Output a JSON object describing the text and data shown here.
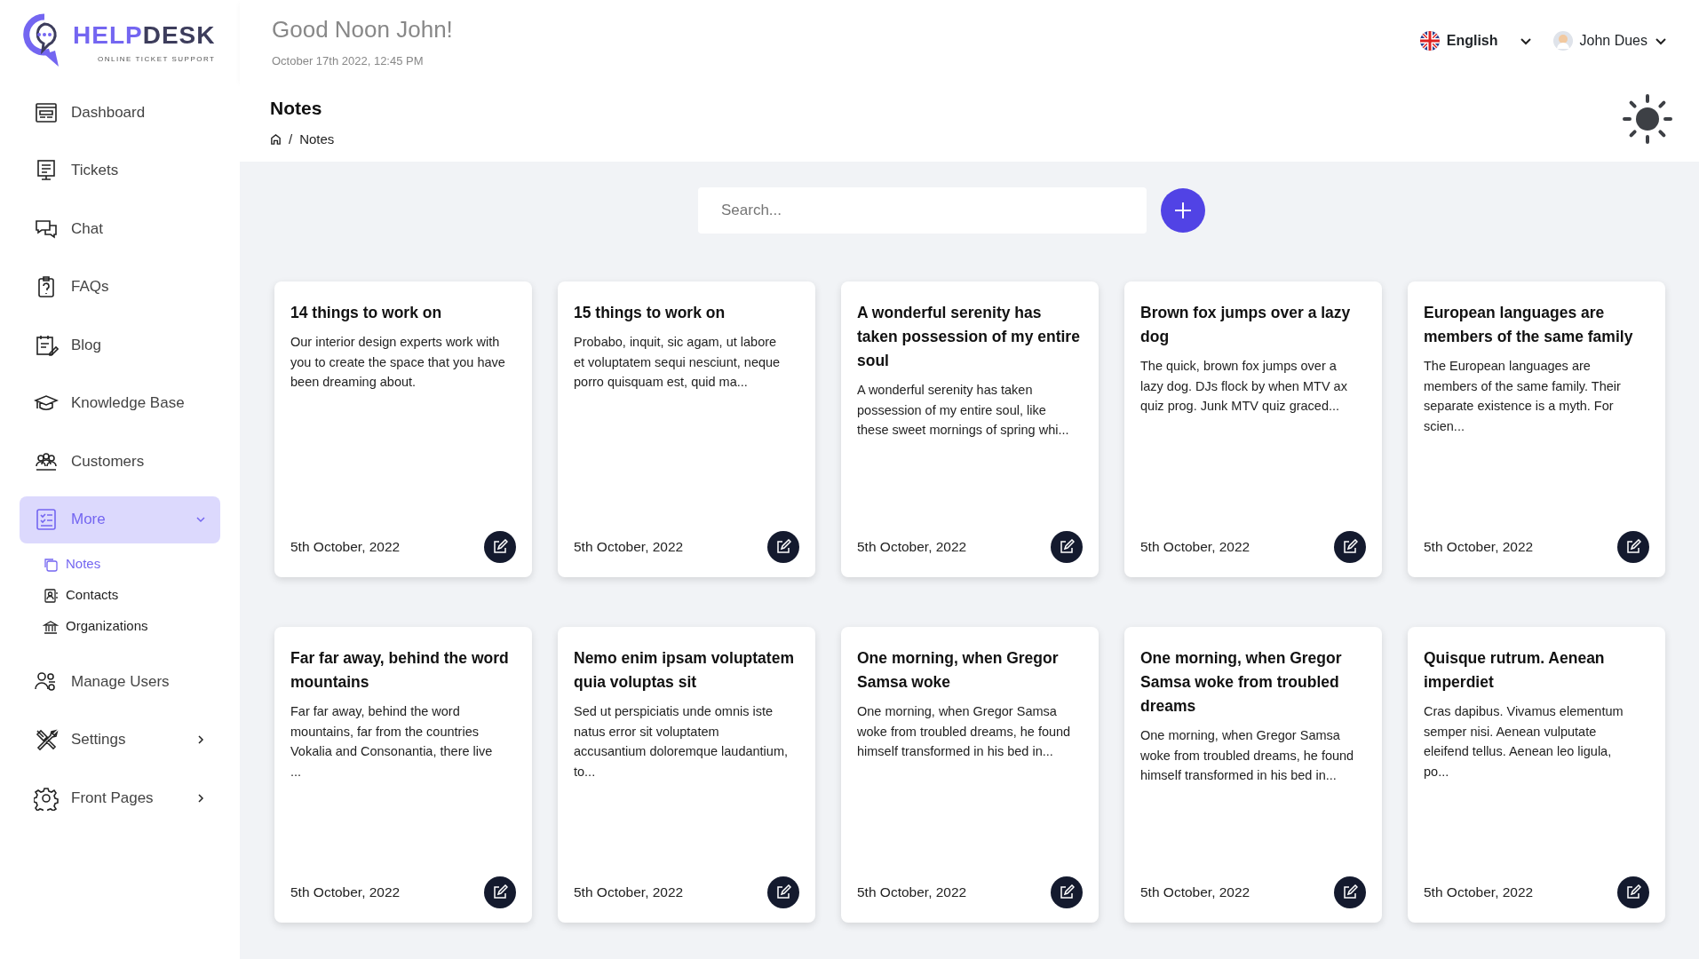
{
  "logo": {
    "name_part1": "HELP",
    "name_part2": "DESK",
    "tagline": "ONLINE TICKET SUPPORT"
  },
  "header": {
    "greeting": "Good Noon John!",
    "datetime": "October 17th 2022, 12:45 PM",
    "language": "English",
    "user": "John Dues"
  },
  "sidebar": {
    "items": [
      {
        "label": "Dashboard",
        "selected": false
      },
      {
        "label": "Tickets",
        "selected": false
      },
      {
        "label": "Chat",
        "selected": false
      },
      {
        "label": "FAQs",
        "selected": false
      },
      {
        "label": "Blog",
        "selected": false
      },
      {
        "label": "Knowledge Base",
        "selected": false
      },
      {
        "label": "Customers",
        "selected": false
      },
      {
        "label": "More",
        "selected": true,
        "expanded": true,
        "children": [
          {
            "label": "Notes",
            "selected": true
          },
          {
            "label": "Contacts",
            "selected": false
          },
          {
            "label": "Organizations",
            "selected": false
          }
        ]
      },
      {
        "label": "Manage Users",
        "selected": false
      },
      {
        "label": "Settings",
        "selected": false,
        "expanded": false
      },
      {
        "label": "Front Pages",
        "selected": false,
        "expanded": false
      }
    ]
  },
  "page": {
    "title": "Notes",
    "breadcrumb": [
      {
        "separator": "/",
        "label": "Notes"
      }
    ]
  },
  "search": {
    "placeholder": "Search..."
  },
  "notes": [
    {
      "title": "14 things to work on",
      "body": "Our interior design experts work with you to create the space that you have been dreaming about.",
      "date": "5th October, 2022"
    },
    {
      "title": "15 things to work on",
      "body": "Probabo, inquit, sic agam, ut labore et voluptatem sequi nesciunt, neque porro quisquam est, quid ma...",
      "date": "5th October, 2022"
    },
    {
      "title": "A wonderful serenity has taken possession of my entire soul",
      "body": "A wonderful serenity has taken possession of my entire soul, like these sweet mornings of spring whi...",
      "date": "5th October, 2022"
    },
    {
      "title": "Brown fox jumps over a lazy dog",
      "body": "The quick, brown fox jumps over a lazy dog. DJs flock by when MTV ax quiz prog. Junk MTV quiz graced...",
      "date": "5th October, 2022"
    },
    {
      "title": "European languages are members of the same family",
      "body": "The European languages are members of the same family. Their separate existence is a myth. For scien...",
      "date": "5th October, 2022"
    },
    {
      "title": "Far far away, behind the word mountains",
      "body": "Far far away, behind the word mountains, far from the countries Vokalia and Consonantia, there live ...",
      "date": "5th October, 2022"
    },
    {
      "title": "Nemo enim ipsam voluptatem quia voluptas sit",
      "body": "Sed ut perspiciatis unde omnis iste natus error sit voluptatem accusantium doloremque laudantium, to...",
      "date": "5th October, 2022"
    },
    {
      "title": "One morning, when Gregor Samsa woke",
      "body": "One morning, when Gregor Samsa woke from troubled dreams, he found himself transformed in his bed in...",
      "date": "5th October, 2022"
    },
    {
      "title": "One morning, when Gregor Samsa woke from troubled dreams",
      "body": "One morning, when Gregor Samsa woke from troubled dreams, he found himself transformed in his bed in...",
      "date": "5th October, 2022"
    },
    {
      "title": "Quisque rutrum. Aenean imperdiet",
      "body": "Cras dapibus. Vivamus elementum semper nisi. Aenean vulputate eleifend tellus. Aenean leo ligula, po...",
      "date": "5th October, 2022"
    }
  ]
}
